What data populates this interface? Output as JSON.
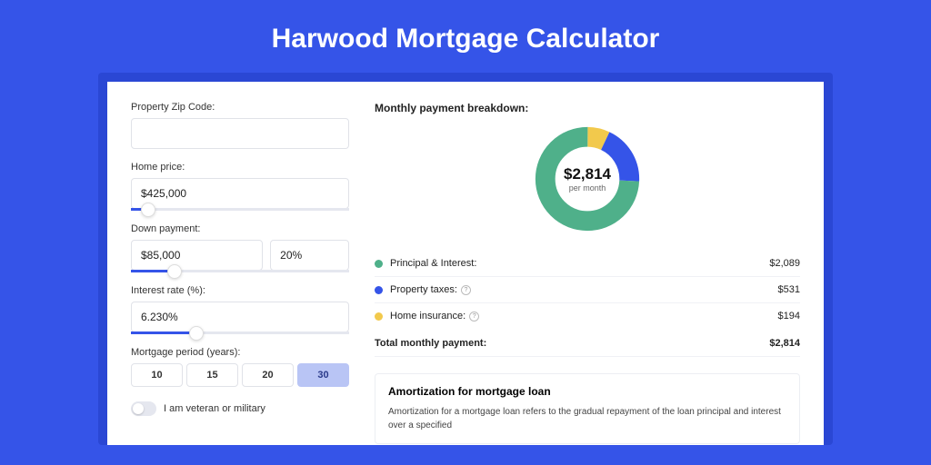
{
  "title": "Harwood Mortgage Calculator",
  "form": {
    "zip": {
      "label": "Property Zip Code:",
      "value": ""
    },
    "home_price": {
      "label": "Home price:",
      "value": "$425,000",
      "slider_pct": 8
    },
    "down_payment": {
      "label": "Down payment:",
      "amount": "$85,000",
      "percent": "20%",
      "slider_pct": 20
    },
    "interest": {
      "label": "Interest rate (%):",
      "value": "6.230%",
      "slider_pct": 30
    },
    "period": {
      "label": "Mortgage period (years):",
      "options": [
        "10",
        "15",
        "20",
        "30"
      ],
      "selected": "30"
    },
    "veteran": {
      "label": "I am veteran or military",
      "on": false
    }
  },
  "breakdown": {
    "title": "Monthly payment breakdown:",
    "center_amount": "$2,814",
    "center_sub": "per month",
    "items": [
      {
        "label": "Principal & Interest:",
        "value": "$2,089",
        "color": "#4fb08a",
        "info": false
      },
      {
        "label": "Property taxes:",
        "value": "$531",
        "color": "#3554e8",
        "info": true
      },
      {
        "label": "Home insurance:",
        "value": "$194",
        "color": "#f2c94c",
        "info": true
      }
    ],
    "total": {
      "label": "Total monthly payment:",
      "value": "$2,814"
    }
  },
  "chart_data": {
    "type": "pie",
    "title": "Monthly payment breakdown",
    "series": [
      {
        "name": "Principal & Interest",
        "value": 2089,
        "color": "#4fb08a"
      },
      {
        "name": "Property taxes",
        "value": 531,
        "color": "#3554e8"
      },
      {
        "name": "Home insurance",
        "value": 194,
        "color": "#f2c94c"
      }
    ],
    "total": 2814
  },
  "amortization": {
    "title": "Amortization for mortgage loan",
    "text": "Amortization for a mortgage loan refers to the gradual repayment of the loan principal and interest over a specified"
  }
}
